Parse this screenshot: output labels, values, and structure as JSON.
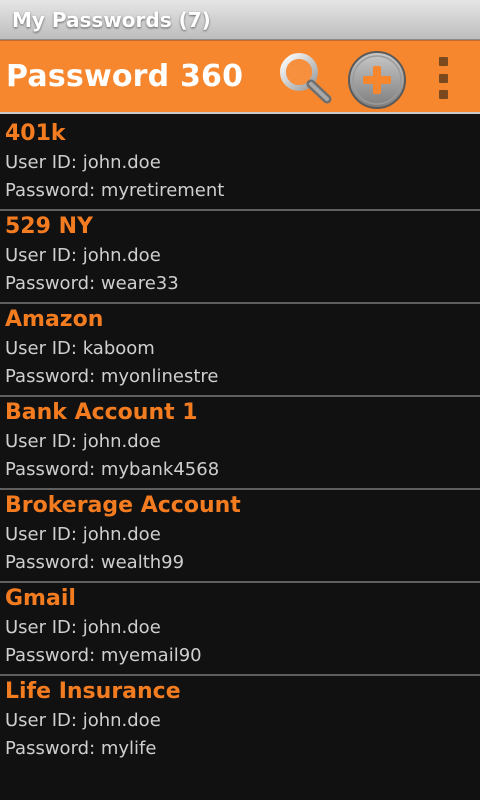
{
  "status_title": "My Passwords (7)",
  "app": {
    "name": "Password 360"
  },
  "actions": {
    "search_icon": "search-icon",
    "add_icon": "add-icon",
    "overflow_icon": "overflow-menu-icon"
  },
  "colors": {
    "accent": "#f6872f",
    "entry_title": "#f47c20",
    "background": "#111111"
  },
  "entries": [
    {
      "name": "401k",
      "user_id": "User ID: john.doe",
      "password": "Password: myretirement"
    },
    {
      "name": "529 NY",
      "user_id": "User ID: john.doe",
      "password": "Password: weare33"
    },
    {
      "name": "Amazon",
      "user_id": "User ID: kaboom",
      "password": "Password: myonlinestre"
    },
    {
      "name": "Bank Account 1",
      "user_id": "User ID: john.doe",
      "password": "Password: mybank4568"
    },
    {
      "name": "Brokerage Account",
      "user_id": "User ID: john.doe",
      "password": "Password: wealth99"
    },
    {
      "name": "Gmail",
      "user_id": "User ID: john.doe",
      "password": "Password: myemail90"
    },
    {
      "name": "Life Insurance",
      "user_id": "User ID: john.doe",
      "password": "Password: mylife"
    }
  ]
}
